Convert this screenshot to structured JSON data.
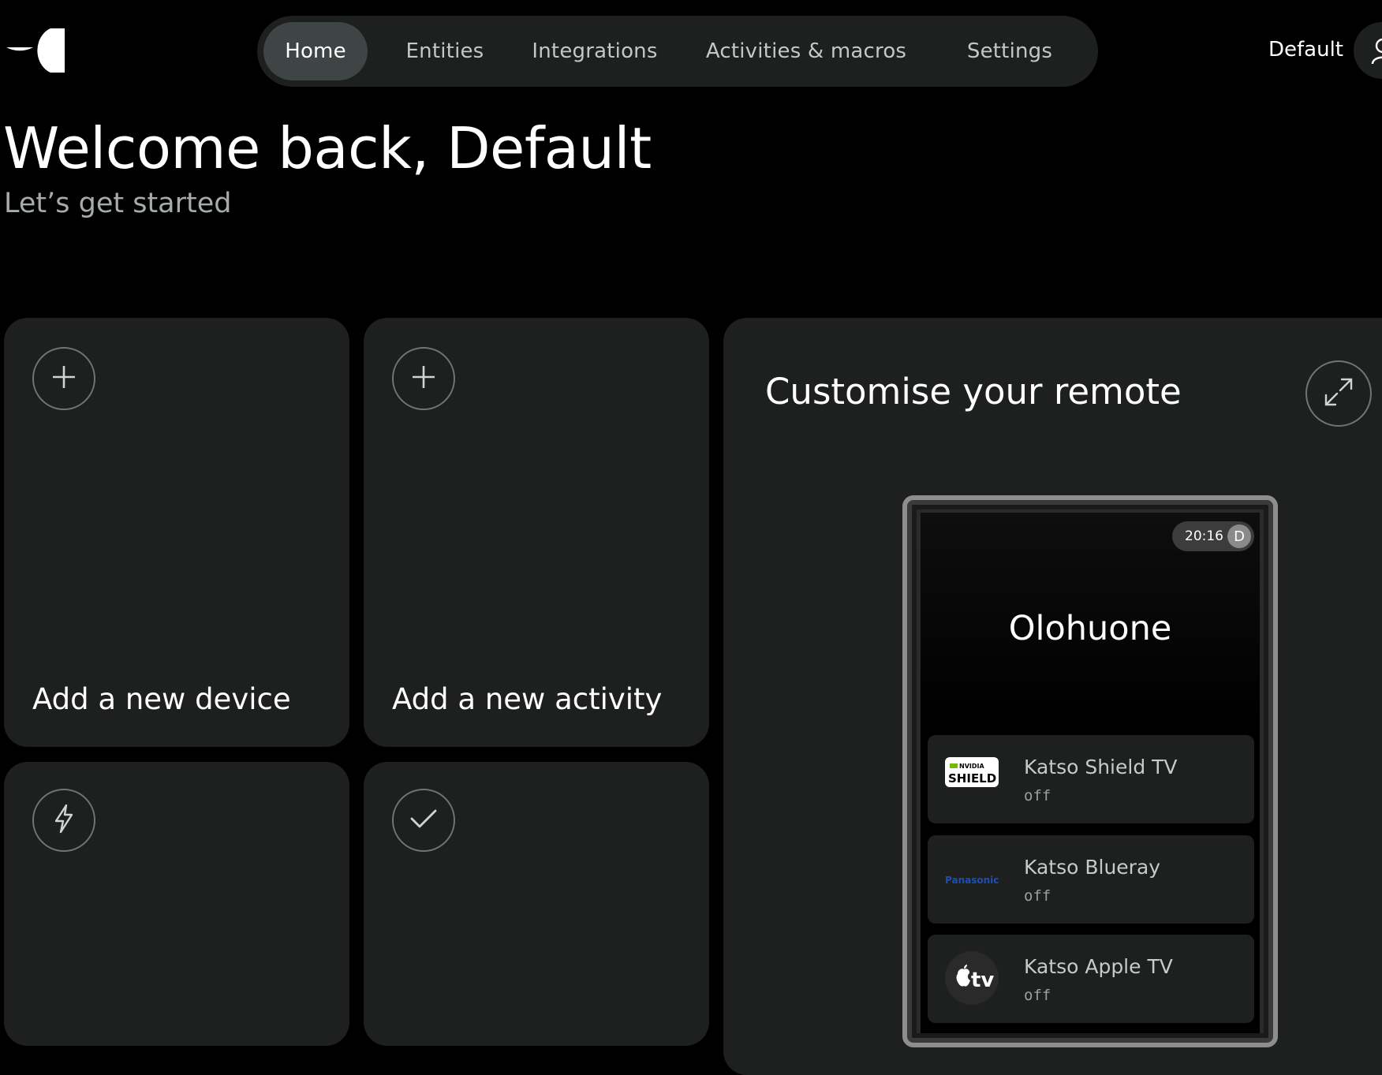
{
  "header": {
    "nav": [
      {
        "label": "Home",
        "active": true
      },
      {
        "label": "Entities",
        "active": false
      },
      {
        "label": "Integrations",
        "active": false
      },
      {
        "label": "Activities & macros",
        "active": false
      },
      {
        "label": "Settings",
        "active": false
      }
    ],
    "user_name": "Default"
  },
  "main": {
    "welcome": "Welcome back, Default",
    "subtitle": "Let’s get started",
    "cards": {
      "add_device": "Add a new device",
      "add_activity": "Add a new activity"
    },
    "remote": {
      "title": "Customise your remote",
      "status_time": "20:16",
      "status_initial": "D",
      "room": "Olohuone",
      "devices": [
        {
          "name": "Katso Shield TV",
          "state": "off",
          "logo": "nvidia-shield-logo",
          "logo_text_top": "NVIDIA",
          "logo_text_bottom": "SHIELD"
        },
        {
          "name": "Katso Blueray",
          "state": "off",
          "logo": "panasonic-logo",
          "logo_text": "Panasonic"
        },
        {
          "name": "Katso Apple TV",
          "state": "off",
          "logo": "apple-tv-logo",
          "logo_text": "tv"
        }
      ]
    }
  },
  "colors": {
    "background": "#000000",
    "card": "#1e1f1f",
    "nav_active": "#3f4545",
    "muted_text": "#a6abab",
    "nvidia_green": "#76b900",
    "panasonic_blue": "#1e4fb3"
  },
  "icons": [
    "app-logo",
    "user-icon",
    "plus-icon",
    "lightning-icon",
    "check-icon",
    "expand-icon"
  ]
}
